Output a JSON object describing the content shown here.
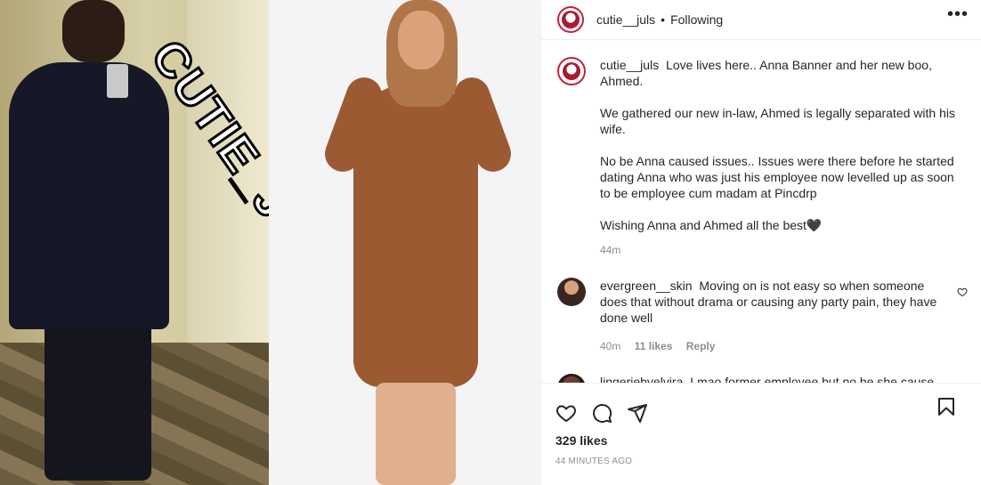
{
  "post": {
    "watermark": "CUTIE_JULS"
  },
  "header": {
    "username": "cutie__juls",
    "separator": "•",
    "follow_status": "Following",
    "more_label": "•••"
  },
  "caption": {
    "username": "cutie__juls",
    "paragraphs": [
      "Love lives here.. Anna Banner and her new boo, Ahmed.",
      "We gathered our new in-law, Ahmed is legally separated with his wife.",
      "No be Anna caused issues.. Issues were there before he started dating Anna who was just his employee now levelled up as soon to be employee cum madam at Pincdrp",
      "Wishing Anna and Ahmed all the best🖤"
    ],
    "time": "44m"
  },
  "comments": [
    {
      "username": "evergreen__skin",
      "text": "Moving on is not easy so when someone does that without drama or causing any party pain, they have done well",
      "time": "40m",
      "likes": "11 likes",
      "reply": "Reply"
    },
    {
      "username": "lingeriebyelvira",
      "text": "Lmao former employee but no be she cause",
      "time": "",
      "likes": "",
      "reply": ""
    }
  ],
  "actions": {
    "likes_count": "329 likes",
    "posted_time": "44 MINUTES AGO"
  },
  "icons": [
    "heart-icon",
    "comment-icon",
    "share-icon",
    "save-icon",
    "more-icon"
  ]
}
